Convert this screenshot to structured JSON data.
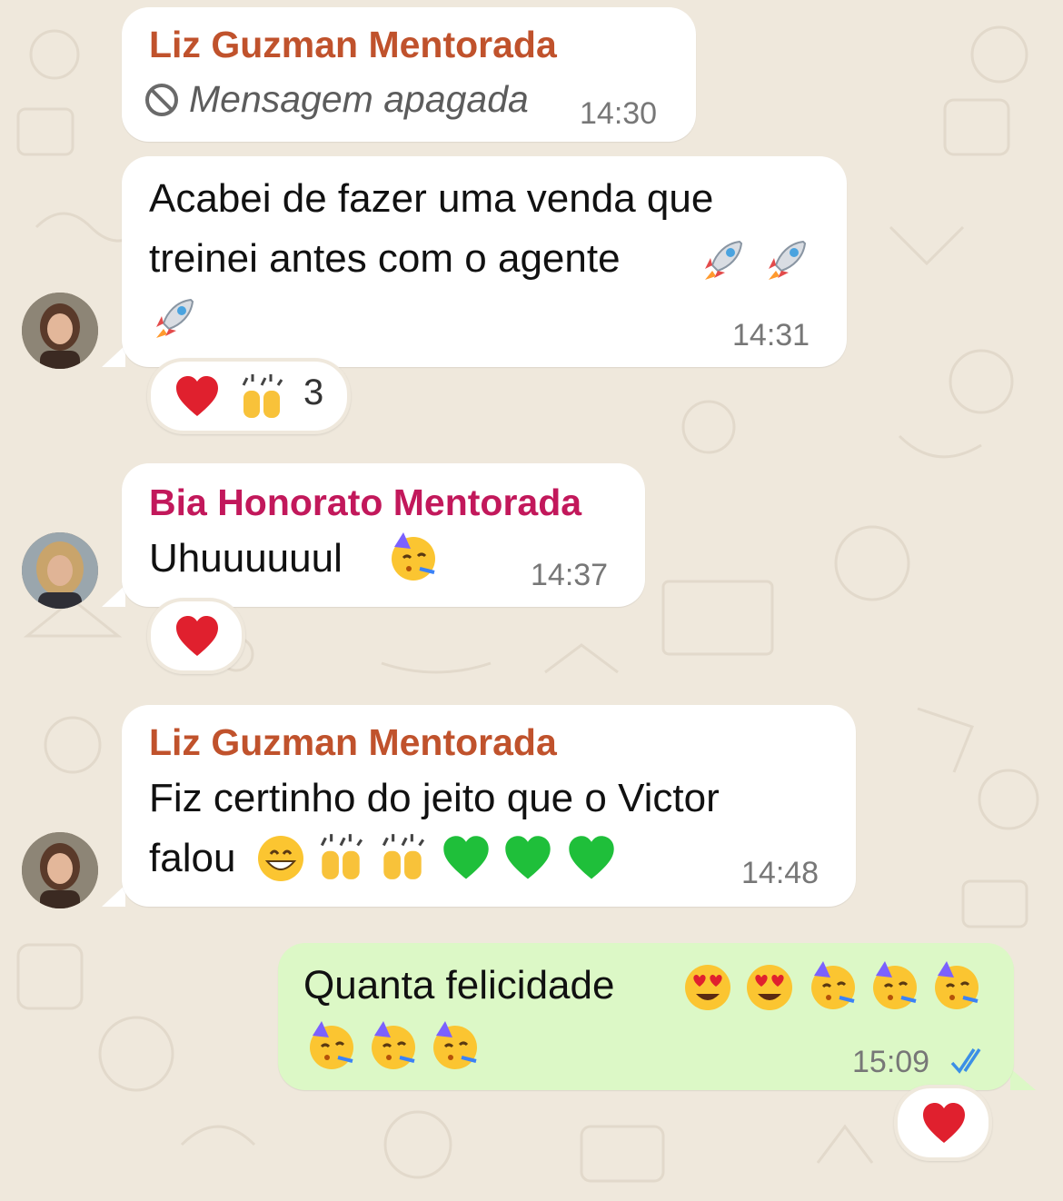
{
  "colors": {
    "background": "#efe8dc",
    "incoming_bubble": "#ffffff",
    "outgoing_bubble": "#dcf8c6",
    "sender_liz": "#c0522c",
    "sender_bia": "#c2185b",
    "read_ticks": "#3b8fe6"
  },
  "messages": [
    {
      "sender": "Liz Guzman Mentorada",
      "deleted_text": "Mensagem apagada",
      "deleted_icon": "blocked-icon",
      "time": "14:30"
    },
    {
      "line1": "Acabei de fazer uma venda que",
      "line2": "treinei antes com o agente",
      "emojis": [
        "rocket",
        "rocket",
        "rocket"
      ],
      "time": "14:31",
      "reaction": {
        "emojis": [
          "red-heart",
          "raising-hands"
        ],
        "count": "3"
      }
    },
    {
      "sender": "Bia Honorato Mentorada",
      "text": "Uhuuuuuul",
      "emojis": [
        "partying-face"
      ],
      "time": "14:37",
      "reaction": {
        "emojis": [
          "red-heart"
        ]
      }
    },
    {
      "sender": "Liz Guzman Mentorada",
      "line1": "Fiz certinho do jeito que o Victor",
      "line2": "falou",
      "emojis": [
        "grinning-face",
        "raising-hands",
        "raising-hands",
        "green-heart",
        "green-heart",
        "green-heart"
      ],
      "time": "14:48"
    },
    {
      "line1": "Quanta felicidade",
      "emojis": [
        "heart-eyes",
        "heart-eyes",
        "partying-face",
        "partying-face",
        "partying-face",
        "partying-face",
        "partying-face",
        "partying-face"
      ],
      "time": "15:09",
      "status": "read-ticks-icon",
      "reaction": {
        "emojis": [
          "red-heart"
        ]
      }
    }
  ]
}
